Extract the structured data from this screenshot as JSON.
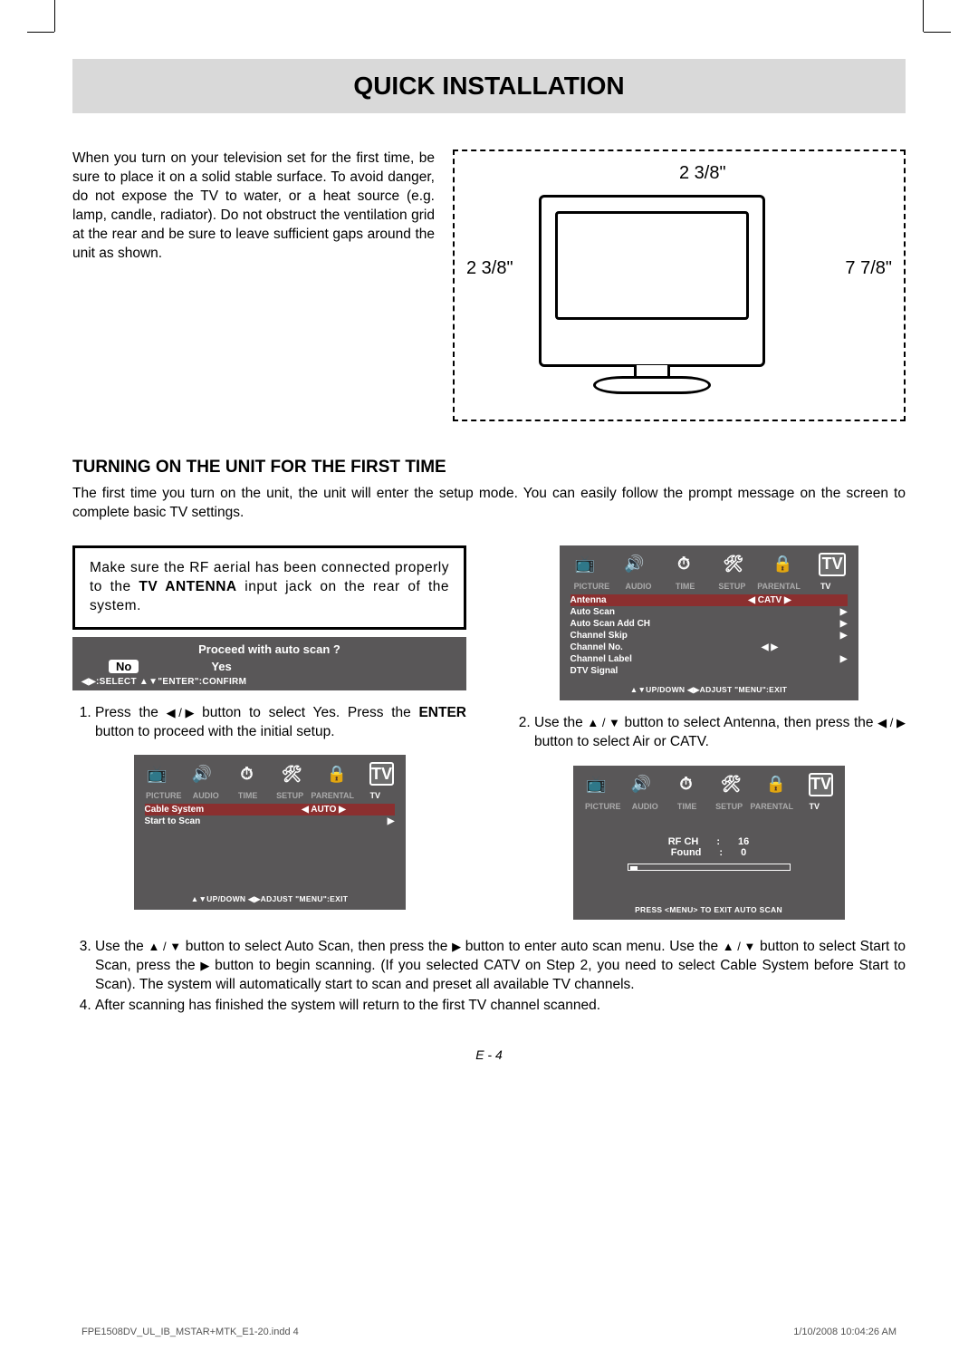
{
  "header": {
    "title": "QUICK INSTALLATION"
  },
  "intro": {
    "text": "When you turn on your television set for the first time, be sure to place it on a solid stable surface. To avoid danger, do not expose the TV to water, or a heat source (e.g. lamp, candle, radiator). Do not obstruct the ventilation grid at the rear and be sure to leave sufficient gaps around the unit as shown."
  },
  "dimensions": {
    "top": "2 3/8\"",
    "left": "2 3/8\"",
    "right": "7 7/8\""
  },
  "section": {
    "heading": "TURNING ON THE UNIT FOR THE FIRST TIME",
    "text": "The first time you turn on the unit, the unit will enter the setup mode. You can easily follow the prompt message on the screen to complete basic TV settings."
  },
  "note": {
    "line1": "Make sure the RF aerial has been connected properly to the ",
    "bold": "TV ANTENNA",
    "line2": " input jack on the rear of the system."
  },
  "dialog": {
    "question": "Proceed with auto scan ?",
    "no": "No",
    "yes": "Yes",
    "hint": "◀▶:SELECT   ▲▼\"ENTER\":CONFIRM"
  },
  "osd": {
    "tabs": [
      "PICTURE",
      "AUDIO",
      "TIME",
      "SETUP",
      "PARENTAL",
      "TV"
    ],
    "menu1": {
      "rows": [
        {
          "lbl": "Antenna",
          "val": "CATV",
          "lr": true,
          "sel": true
        },
        {
          "lbl": "Auto Scan",
          "val": "",
          "r": true
        },
        {
          "lbl": "Auto Scan Add CH",
          "val": "",
          "r": true
        },
        {
          "lbl": "Channel Skip",
          "val": "",
          "r": true
        },
        {
          "lbl": "Channel No.",
          "val": "",
          "lr": true
        },
        {
          "lbl": "Channel Label",
          "val": "",
          "r": true
        },
        {
          "lbl": "DTV Signal",
          "val": "",
          "r": false
        }
      ],
      "footer": "▲▼UP/DOWN  ◀▶ADJUST  \"MENU\":EXIT"
    },
    "menu2": {
      "rows": [
        {
          "lbl": "Cable System",
          "val": "AUTO",
          "lr": true,
          "sel": true
        },
        {
          "lbl": "Start to Scan",
          "val": "",
          "r": true
        }
      ],
      "footer": "▲▼UP/DOWN  ◀▶ADJUST  \"MENU\":EXIT"
    },
    "scanning": {
      "rfch_lbl": "RF CH",
      "rfch_val": "16",
      "found_lbl": "Found",
      "found_val": "0",
      "footer": "PRESS <MENU> TO EXIT AUTO SCAN"
    }
  },
  "steps": {
    "s1a": "Press the ",
    "s1b": " button to select Yes. Press the ",
    "s1bold": "ENTER",
    "s1c": " button to proceed with the initial setup.",
    "s2a": "Use the ",
    "s2b": " button to select Antenna, then press the ",
    "s2c": " button to select Air or CATV.",
    "s3a": "Use the ",
    "s3b": " button to select Auto Scan, then press the ",
    "s3c": " button to enter auto scan menu. Use the ",
    "s3d": " button to select Start to Scan, press the ",
    "s3e": " button to begin scanning. (If you selected CATV on Step 2, you need to select Cable System before Start to Scan). The system will automatically start to scan and preset all available TV channels.",
    "s4": "After scanning has finished the system will return to the first TV channel scanned."
  },
  "pagenum": "E - 4",
  "footer": {
    "left": "FPE1508DV_UL_IB_MSTAR+MTK_E1-20.indd   4",
    "right": "1/10/2008   10:04:26 AM"
  }
}
